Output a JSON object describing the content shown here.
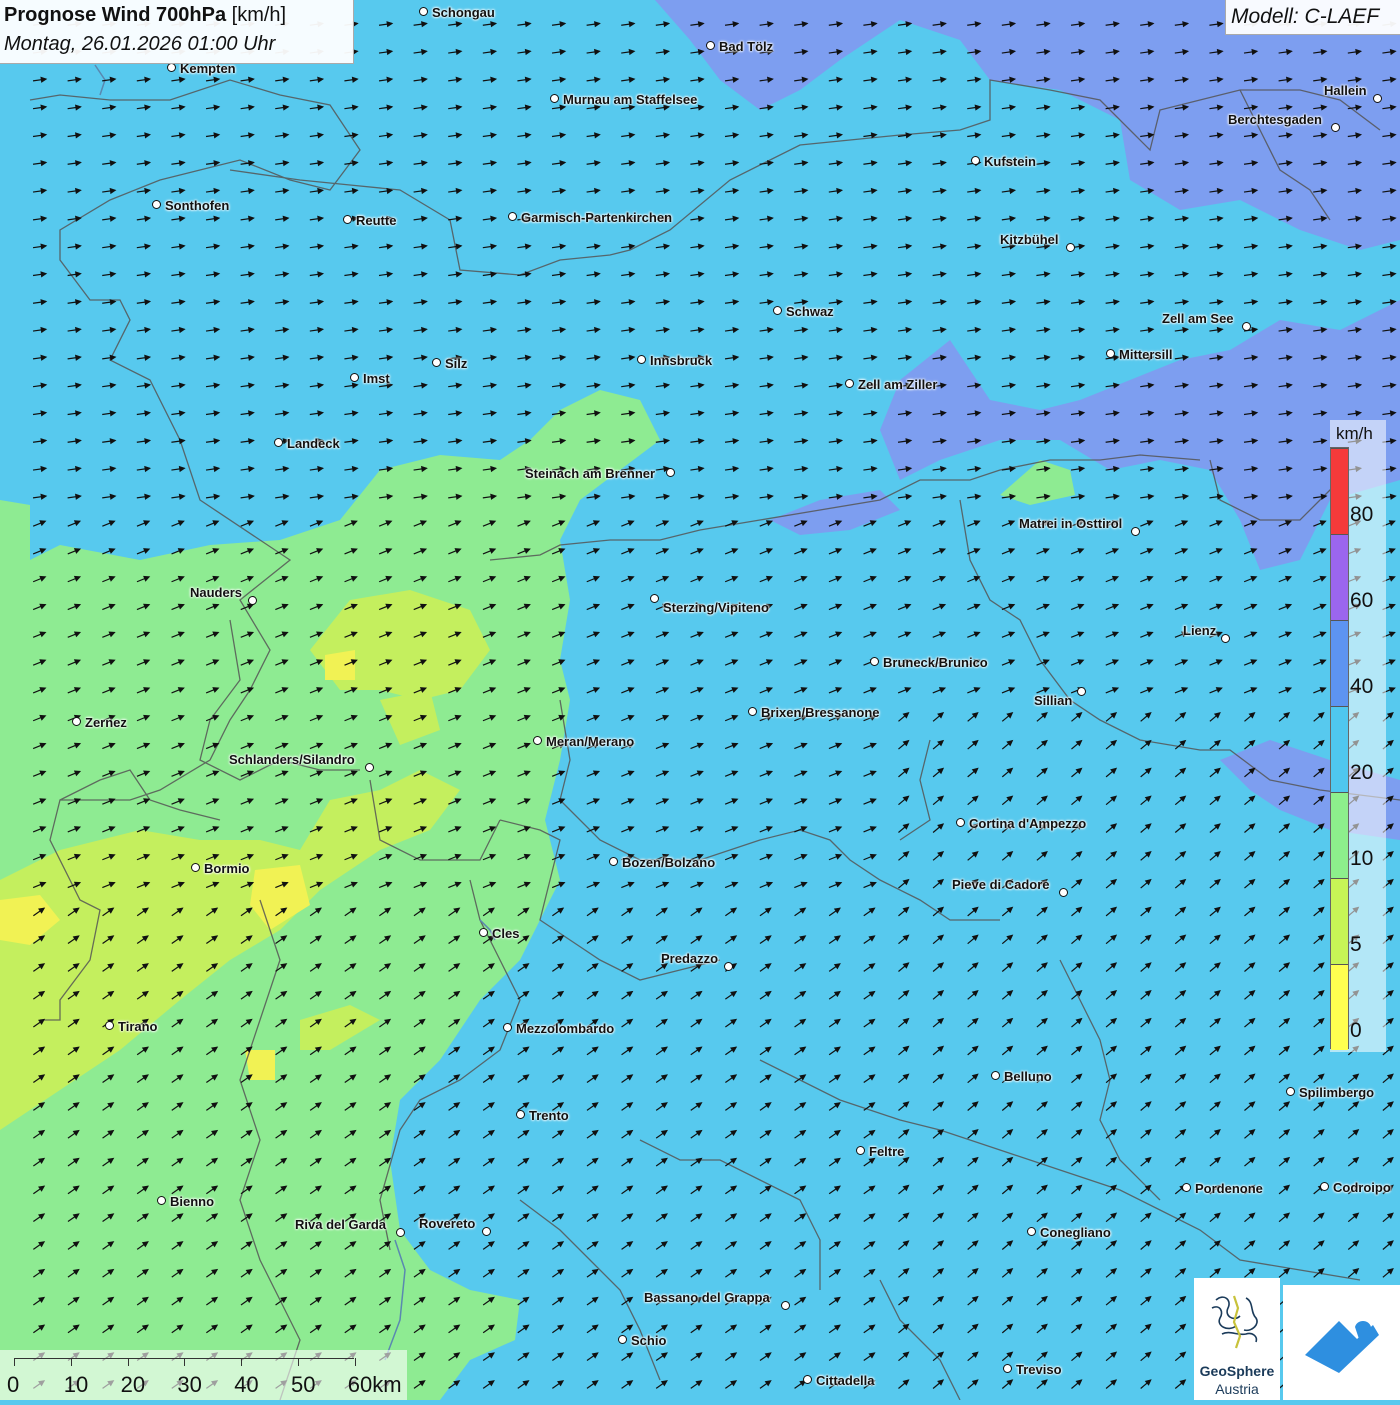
{
  "title": {
    "main": "Prognose Wind 700hPa",
    "unit": "[km/h]",
    "date": "Montag, 26.01.2026 01:00 Uhr"
  },
  "model": "Modell: C-LAEF",
  "legend": {
    "unit": "km/h",
    "ticks": [
      "0",
      "5",
      "10",
      "20",
      "40",
      "60",
      "80"
    ],
    "colors": [
      "#ffff50",
      "#c7f556",
      "#8def8c",
      "#4fc7ef",
      "#5d94f1",
      "#9b66ee",
      "#f53a3a"
    ]
  },
  "scale_bar": {
    "labels": [
      "0",
      "10",
      "20",
      "30",
      "40",
      "50",
      "60km"
    ]
  },
  "logos": {
    "geosphere_line1": "GeoSphere",
    "geosphere_line2": "Austria"
  },
  "map_colors": {
    "below_10": "#8fec92",
    "10_20": "#5fcbef",
    "20_40": "#7a9ef0",
    "5_10": "#c4ef5e"
  },
  "wind_direction": "from west-southwest",
  "cities": [
    {
      "name": "Schongau"
    },
    {
      "name": "Bad Tölz"
    },
    {
      "name": "Kempten"
    },
    {
      "name": "Murnau am Staffelsee"
    },
    {
      "name": "Hallein"
    },
    {
      "name": "Berchtesgaden"
    },
    {
      "name": "Kufstein"
    },
    {
      "name": "Sonthofen"
    },
    {
      "name": "Reutte"
    },
    {
      "name": "Garmisch-Partenkirchen"
    },
    {
      "name": "Kitzbühel"
    },
    {
      "name": "Schwaz"
    },
    {
      "name": "Zell am See"
    },
    {
      "name": "Mittersill"
    },
    {
      "name": "Imst"
    },
    {
      "name": "Silz"
    },
    {
      "name": "Innsbruck"
    },
    {
      "name": "Zell am Ziller"
    },
    {
      "name": "Landeck"
    },
    {
      "name": "Steinach am Brenner"
    },
    {
      "name": "Matrei in Osttirol"
    },
    {
      "name": "Nauders"
    },
    {
      "name": "Sterzing/Vipiteno"
    },
    {
      "name": "Lienz"
    },
    {
      "name": "Bruneck/Brunico"
    },
    {
      "name": "Sillian"
    },
    {
      "name": "Zernez"
    },
    {
      "name": "Brixen/Bressanone"
    },
    {
      "name": "Meran/Merano"
    },
    {
      "name": "Schlanders/Silandro"
    },
    {
      "name": "Cortina d'Ampezzo"
    },
    {
      "name": "Bozen/Bolzano"
    },
    {
      "name": "Bormio"
    },
    {
      "name": "Pieve di Cadore"
    },
    {
      "name": "Cles"
    },
    {
      "name": "Predazzo"
    },
    {
      "name": "Tirano"
    },
    {
      "name": "Mezzolombardo"
    },
    {
      "name": "Belluno"
    },
    {
      "name": "Spilimbergo"
    },
    {
      "name": "Trento"
    },
    {
      "name": "Feltre"
    },
    {
      "name": "Pordenone"
    },
    {
      "name": "Codroipo"
    },
    {
      "name": "Bienno"
    },
    {
      "name": "Riva del Garda"
    },
    {
      "name": "Rovereto"
    },
    {
      "name": "Conegliano"
    },
    {
      "name": "Bassano del Grappa"
    },
    {
      "name": "Schio"
    },
    {
      "name": "Treviso"
    },
    {
      "name": "Cittadella"
    }
  ]
}
